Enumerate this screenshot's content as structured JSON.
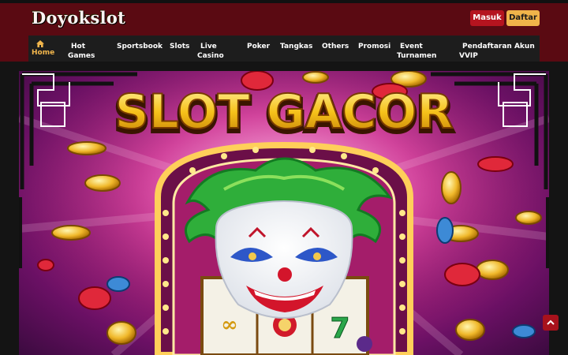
{
  "brand": {
    "name": "Doyokslot"
  },
  "auth": {
    "login_label": "Masuk",
    "register_label": "Daftar"
  },
  "nav": {
    "items": [
      {
        "line1": "",
        "line2": "Home"
      },
      {
        "line1": "Hot",
        "line2": "Games"
      },
      {
        "line1": "Sportsbook",
        "line2": ""
      },
      {
        "line1": "Slots",
        "line2": ""
      },
      {
        "line1": "Live",
        "line2": "Casino"
      },
      {
        "line1": "Poker",
        "line2": ""
      },
      {
        "line1": "Tangkas",
        "line2": ""
      },
      {
        "line1": "Others",
        "line2": ""
      },
      {
        "line1": "Promosi",
        "line2": ""
      },
      {
        "line1": "Event",
        "line2": "Turnamen"
      },
      {
        "line1": "Pendaftaran Akun",
        "line2": "VVIP"
      }
    ]
  },
  "banner": {
    "headline": "SLOT GACOR"
  },
  "icons": {
    "home": "home-icon",
    "scroll_top": "chevron-up-icon"
  },
  "colors": {
    "header": "#5a0a12",
    "accent": "#f2b64c",
    "login": "#b5141f",
    "register": "#f0b44a"
  }
}
